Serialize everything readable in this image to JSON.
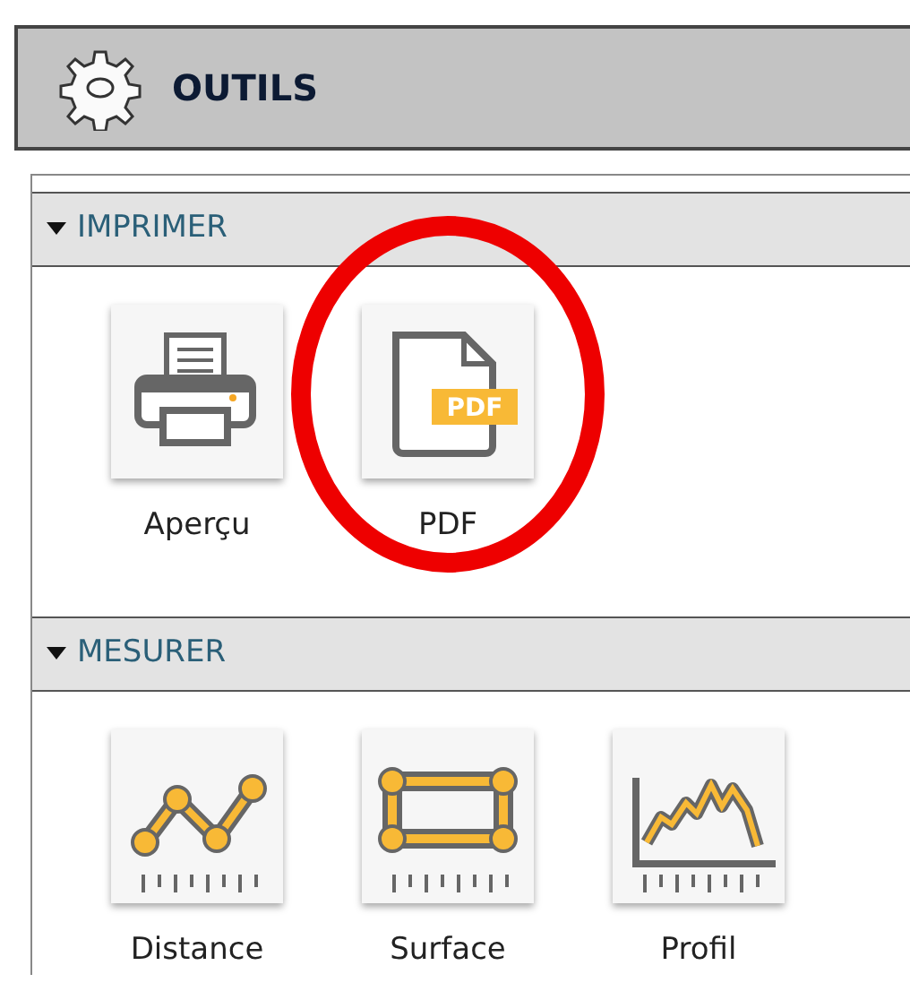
{
  "panel": {
    "title": "OUTILS"
  },
  "sections": [
    {
      "title": "IMPRIMER",
      "expanded": true,
      "tools": [
        {
          "label": "Aperçu",
          "kind": "printer",
          "highlighted": false
        },
        {
          "label": "PDF",
          "kind": "pdf",
          "icon_text": "PDF",
          "highlighted": true
        }
      ]
    },
    {
      "title": "MESURER",
      "expanded": true,
      "tools": [
        {
          "label": "Distance",
          "kind": "distance",
          "highlighted": false
        },
        {
          "label": "Surface",
          "kind": "surface",
          "highlighted": false
        },
        {
          "label": "Profil",
          "kind": "profile",
          "highlighted": false
        }
      ]
    }
  ]
}
